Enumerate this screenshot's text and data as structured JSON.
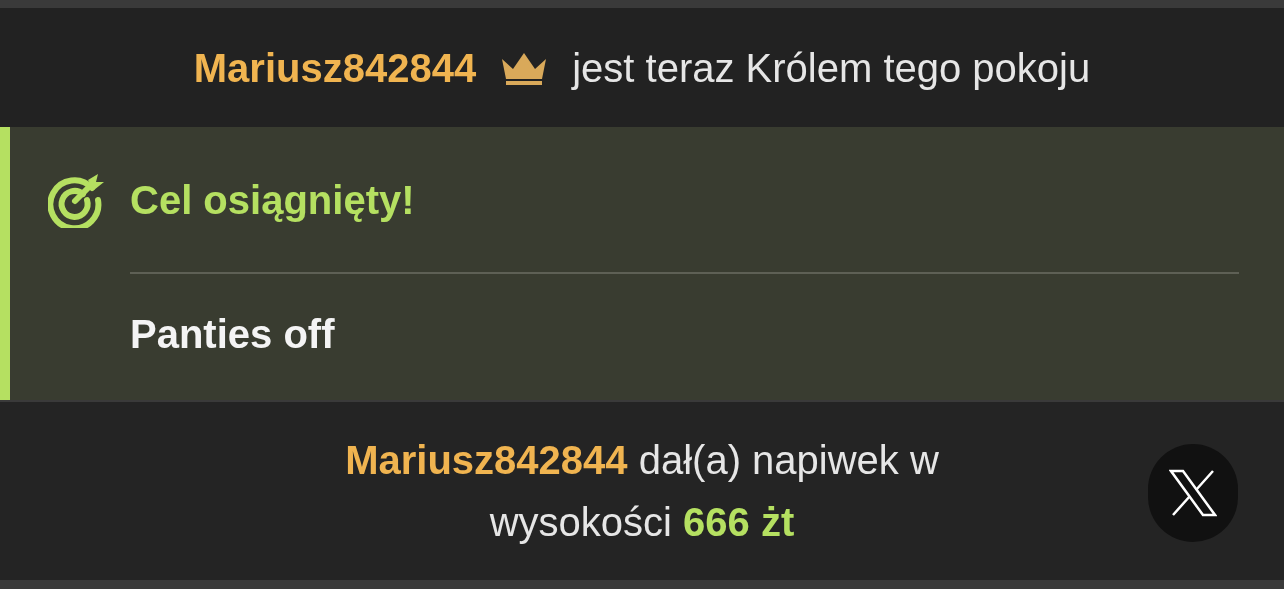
{
  "king_notice": {
    "username": "Mariusz842844",
    "text": "jest teraz Królem tego pokoju"
  },
  "goal": {
    "title": "Cel osiągnięty!",
    "description": "Panties off"
  },
  "tip_notice": {
    "username": "Mariusz842844",
    "text": "dał(a) napiwek w wysokości",
    "amount": "666 żt"
  }
}
